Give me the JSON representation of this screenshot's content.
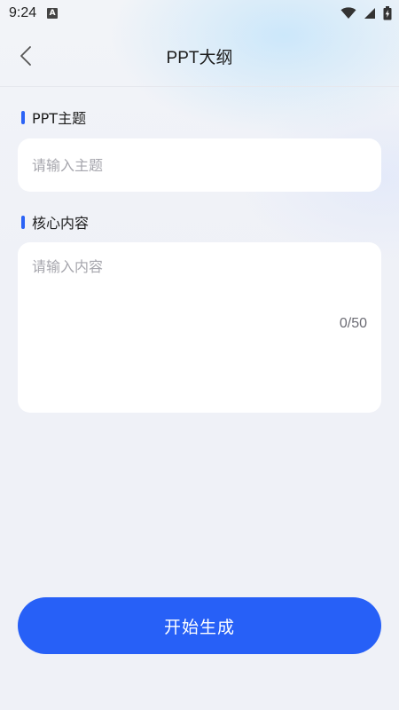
{
  "status_bar": {
    "time": "9:24",
    "notification_icon": "a-icon",
    "icons": [
      "wifi-icon",
      "signal-icon",
      "battery-charging-icon"
    ]
  },
  "header": {
    "back_icon": "chevron-left-icon",
    "title": "PPT大纲"
  },
  "topic": {
    "label": "PPT主题",
    "placeholder": "请输入主题",
    "value": ""
  },
  "content": {
    "label": "核心内容",
    "placeholder": "请输入内容",
    "value": "",
    "counter": "0/50"
  },
  "submit": {
    "label": "开始生成"
  },
  "colors": {
    "accent": "#2760f7",
    "background": "#eff1f7",
    "card": "#ffffff",
    "placeholder": "#a6a6ad"
  }
}
